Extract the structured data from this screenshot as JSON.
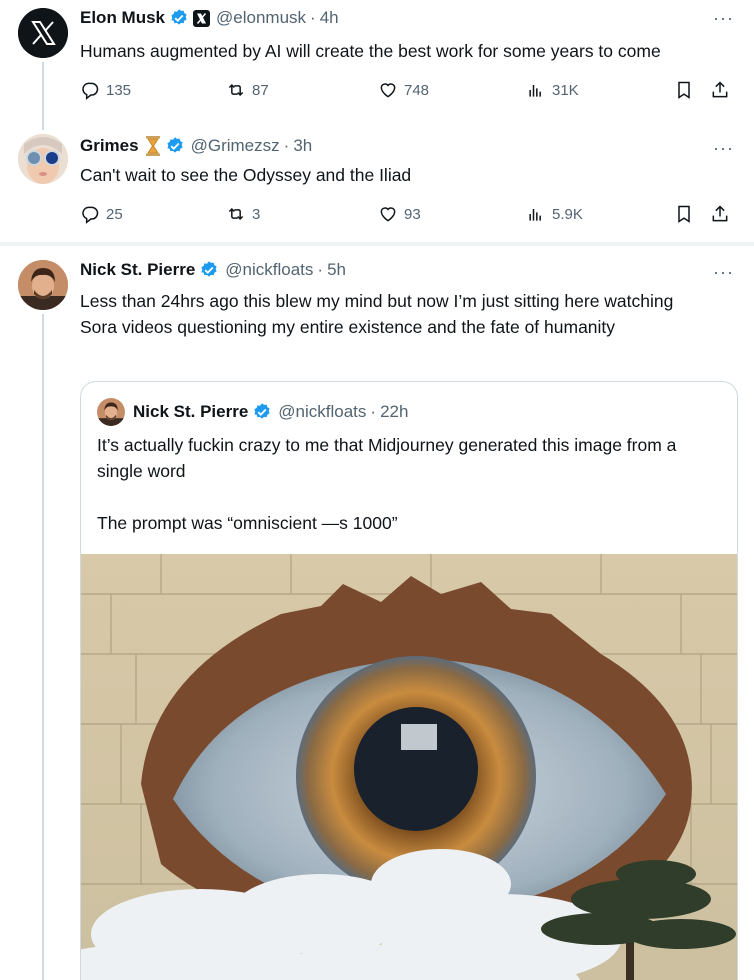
{
  "tweets": [
    {
      "name": "Elon Musk",
      "handle": "@elonmusk",
      "sep": "·",
      "time": "4h",
      "text": "Humans augmented by AI will create the best work for some years to come",
      "stats": {
        "replies": "135",
        "reposts": "87",
        "likes": "748",
        "views": "31K"
      }
    },
    {
      "name": "Grimes",
      "handle": "@Grimezsz",
      "sep": "·",
      "time": "3h",
      "text": "Can't wait to see the Odyssey and the Iliad",
      "stats": {
        "replies": "25",
        "reposts": "3",
        "likes": "93",
        "views": "5.9K"
      }
    },
    {
      "name": "Nick St. Pierre",
      "handle": "@nickfloats",
      "sep": "·",
      "time": "5h",
      "text": "Less than 24hrs ago this blew my mind but now I’m just sitting here watching Sora videos questioning my entire existence and the fate of humanity"
    }
  ],
  "quote": {
    "name": "Nick St. Pierre",
    "handle": "@nickfloats",
    "sep": "·",
    "time": "22h",
    "text": "It’s actually fuckin crazy to me that Midjourney generated this image from a single word\n\nThe prompt was “omniscient —s 1000”"
  },
  "more_label": "···",
  "colors": {
    "verified": "#1d9bf0",
    "muted": "#536471",
    "border": "#cfd9de"
  },
  "icons": [
    "x-logo-icon",
    "verified-badge-icon",
    "hourglass-emoji-icon",
    "reply-icon",
    "repost-icon",
    "like-icon",
    "views-icon",
    "bookmark-icon",
    "share-icon",
    "more-icon"
  ]
}
